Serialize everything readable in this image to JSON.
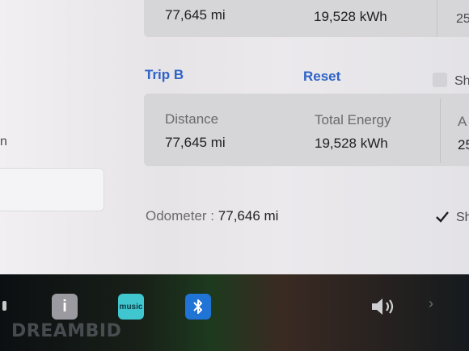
{
  "trip_a": {
    "distance": "77,645 mi",
    "energy": "19,528 kWh",
    "avg_partial": "25"
  },
  "trip_b": {
    "title": "Trip B",
    "reset_label": "Reset",
    "distance_label": "Distance",
    "distance_value": "77,645 mi",
    "energy_label": "Total Energy",
    "energy_value": "19,528 kWh",
    "avg_label_partial": "A",
    "avg_value_partial": "25",
    "show_partial": "Sh"
  },
  "odometer": {
    "label": "Odometer :",
    "value": "77,646 mi"
  },
  "side": {
    "left_partial": "n",
    "show_checked_partial": "Sh"
  },
  "taskbar": {
    "music_label": "music",
    "manual_glyph": "i",
    "watermark": "DREAMBID"
  },
  "colors": {
    "link": "#2e63c8",
    "bluetooth": "#1f74d6",
    "amazon_music": "#3fc6cf"
  }
}
